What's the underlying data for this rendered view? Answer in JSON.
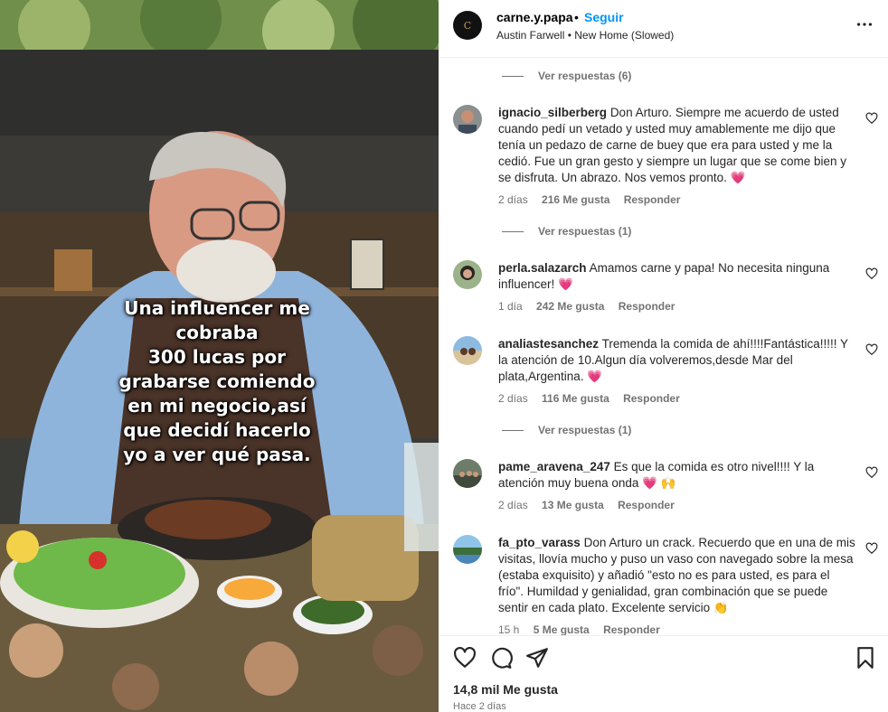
{
  "media": {
    "overlay_lines": [
      "Una influencer me",
      "cobraba",
      "300 lucas por",
      "grabarse comiendo",
      "en mi negocio,así",
      "que decidí hacerlo",
      "yo a ver qué pasa."
    ]
  },
  "header": {
    "username": "carne.y.papa",
    "separator": "•",
    "follow_label": "Seguir",
    "audio": "Austin Farwell • New Home (Slowed)",
    "avatar_glyph": "C"
  },
  "comments": {
    "view_replies_top": "Ver respuestas (6)",
    "items": [
      {
        "username": "ignacio_silberberg",
        "text": "Don Arturo. Siempre me acuerdo de usted cuando pedí un vetado y usted muy amablemente me dijo que tenía un pedazo de carne de buey que era para usted y me la cedió. Fue un gran gesto y siempre un lugar que se come bien y se disfruta. Un abrazo. Nos vemos pronto.",
        "emoji": "💗",
        "time": "2 días",
        "likes": "216 Me gusta",
        "reply": "Responder",
        "replies": "Ver respuestas (1)"
      },
      {
        "username": "perla.salazarch",
        "text": "Amamos carne y papa! No necesita ninguna influencer!",
        "emoji": "💗",
        "time": "1 día",
        "likes": "242 Me gusta",
        "reply": "Responder",
        "replies": ""
      },
      {
        "username": "analiastesanchez",
        "text": "Tremenda la comida de ahí!!!!Fantástica!!!!! Y la atención de 10.Algun día volveremos,desde Mar del plata,Argentina.",
        "emoji": "💗",
        "time": "2 días",
        "likes": "116 Me gusta",
        "reply": "Responder",
        "replies": "Ver respuestas (1)"
      },
      {
        "username": "pame_aravena_247",
        "text": "Es que la comida es otro nivel!!!! Y la atención muy buena onda",
        "emoji": "💗 🙌",
        "time": "2 días",
        "likes": "13 Me gusta",
        "reply": "Responder",
        "replies": ""
      },
      {
        "username": "fa_pto_varass",
        "text": "Don Arturo un crack. Recuerdo que en una de mis visitas, llovía mucho y puso un vaso con navegado sobre la mesa (estaba exquisito) y añadió \"esto no es para usted, es para el frío\". Humildad y genialidad, gran combinación que se puede sentir en cada plato. Excelente servicio",
        "emoji": "👏",
        "time": "15 h",
        "likes": "5 Me gusta",
        "reply": "Responder",
        "replies": ""
      }
    ]
  },
  "actions": {
    "likes_count": "14,8 mil Me gusta",
    "time_ago": "Hace 2 días",
    "icons": [
      "heart-icon",
      "comment-icon",
      "share-icon",
      "bookmark-icon"
    ]
  },
  "colors": {
    "link": "#0095f6",
    "secondary_text": "#737373",
    "heart_emoji": "#e8245c"
  }
}
